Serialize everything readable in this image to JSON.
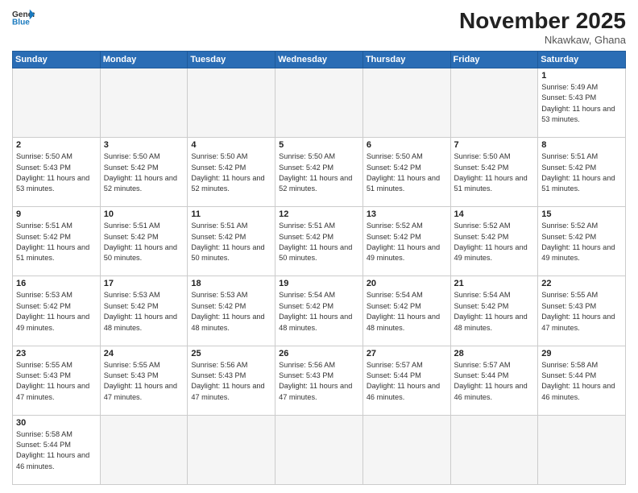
{
  "header": {
    "title": "November 2025",
    "location": "Nkawkaw, Ghana",
    "logo_general": "General",
    "logo_blue": "Blue"
  },
  "days_header": [
    "Sunday",
    "Monday",
    "Tuesday",
    "Wednesday",
    "Thursday",
    "Friday",
    "Saturday"
  ],
  "weeks": [
    {
      "cells": [
        {
          "day": "",
          "empty": true
        },
        {
          "day": "",
          "empty": true
        },
        {
          "day": "",
          "empty": true
        },
        {
          "day": "",
          "empty": true
        },
        {
          "day": "",
          "empty": true
        },
        {
          "day": "",
          "empty": true
        },
        {
          "day": "1",
          "empty": false,
          "sunrise": "Sunrise: 5:49 AM",
          "sunset": "Sunset: 5:43 PM",
          "daylight": "Daylight: 11 hours and 53 minutes."
        }
      ]
    },
    {
      "cells": [
        {
          "day": "2",
          "empty": false,
          "sunrise": "Sunrise: 5:50 AM",
          "sunset": "Sunset: 5:43 PM",
          "daylight": "Daylight: 11 hours and 53 minutes."
        },
        {
          "day": "3",
          "empty": false,
          "sunrise": "Sunrise: 5:50 AM",
          "sunset": "Sunset: 5:42 PM",
          "daylight": "Daylight: 11 hours and 52 minutes."
        },
        {
          "day": "4",
          "empty": false,
          "sunrise": "Sunrise: 5:50 AM",
          "sunset": "Sunset: 5:42 PM",
          "daylight": "Daylight: 11 hours and 52 minutes."
        },
        {
          "day": "5",
          "empty": false,
          "sunrise": "Sunrise: 5:50 AM",
          "sunset": "Sunset: 5:42 PM",
          "daylight": "Daylight: 11 hours and 52 minutes."
        },
        {
          "day": "6",
          "empty": false,
          "sunrise": "Sunrise: 5:50 AM",
          "sunset": "Sunset: 5:42 PM",
          "daylight": "Daylight: 11 hours and 51 minutes."
        },
        {
          "day": "7",
          "empty": false,
          "sunrise": "Sunrise: 5:50 AM",
          "sunset": "Sunset: 5:42 PM",
          "daylight": "Daylight: 11 hours and 51 minutes."
        },
        {
          "day": "8",
          "empty": false,
          "sunrise": "Sunrise: 5:51 AM",
          "sunset": "Sunset: 5:42 PM",
          "daylight": "Daylight: 11 hours and 51 minutes."
        }
      ]
    },
    {
      "cells": [
        {
          "day": "9",
          "empty": false,
          "sunrise": "Sunrise: 5:51 AM",
          "sunset": "Sunset: 5:42 PM",
          "daylight": "Daylight: 11 hours and 51 minutes."
        },
        {
          "day": "10",
          "empty": false,
          "sunrise": "Sunrise: 5:51 AM",
          "sunset": "Sunset: 5:42 PM",
          "daylight": "Daylight: 11 hours and 50 minutes."
        },
        {
          "day": "11",
          "empty": false,
          "sunrise": "Sunrise: 5:51 AM",
          "sunset": "Sunset: 5:42 PM",
          "daylight": "Daylight: 11 hours and 50 minutes."
        },
        {
          "day": "12",
          "empty": false,
          "sunrise": "Sunrise: 5:51 AM",
          "sunset": "Sunset: 5:42 PM",
          "daylight": "Daylight: 11 hours and 50 minutes."
        },
        {
          "day": "13",
          "empty": false,
          "sunrise": "Sunrise: 5:52 AM",
          "sunset": "Sunset: 5:42 PM",
          "daylight": "Daylight: 11 hours and 49 minutes."
        },
        {
          "day": "14",
          "empty": false,
          "sunrise": "Sunrise: 5:52 AM",
          "sunset": "Sunset: 5:42 PM",
          "daylight": "Daylight: 11 hours and 49 minutes."
        },
        {
          "day": "15",
          "empty": false,
          "sunrise": "Sunrise: 5:52 AM",
          "sunset": "Sunset: 5:42 PM",
          "daylight": "Daylight: 11 hours and 49 minutes."
        }
      ]
    },
    {
      "cells": [
        {
          "day": "16",
          "empty": false,
          "sunrise": "Sunrise: 5:53 AM",
          "sunset": "Sunset: 5:42 PM",
          "daylight": "Daylight: 11 hours and 49 minutes."
        },
        {
          "day": "17",
          "empty": false,
          "sunrise": "Sunrise: 5:53 AM",
          "sunset": "Sunset: 5:42 PM",
          "daylight": "Daylight: 11 hours and 48 minutes."
        },
        {
          "day": "18",
          "empty": false,
          "sunrise": "Sunrise: 5:53 AM",
          "sunset": "Sunset: 5:42 PM",
          "daylight": "Daylight: 11 hours and 48 minutes."
        },
        {
          "day": "19",
          "empty": false,
          "sunrise": "Sunrise: 5:54 AM",
          "sunset": "Sunset: 5:42 PM",
          "daylight": "Daylight: 11 hours and 48 minutes."
        },
        {
          "day": "20",
          "empty": false,
          "sunrise": "Sunrise: 5:54 AM",
          "sunset": "Sunset: 5:42 PM",
          "daylight": "Daylight: 11 hours and 48 minutes."
        },
        {
          "day": "21",
          "empty": false,
          "sunrise": "Sunrise: 5:54 AM",
          "sunset": "Sunset: 5:42 PM",
          "daylight": "Daylight: 11 hours and 48 minutes."
        },
        {
          "day": "22",
          "empty": false,
          "sunrise": "Sunrise: 5:55 AM",
          "sunset": "Sunset: 5:43 PM",
          "daylight": "Daylight: 11 hours and 47 minutes."
        }
      ]
    },
    {
      "cells": [
        {
          "day": "23",
          "empty": false,
          "sunrise": "Sunrise: 5:55 AM",
          "sunset": "Sunset: 5:43 PM",
          "daylight": "Daylight: 11 hours and 47 minutes."
        },
        {
          "day": "24",
          "empty": false,
          "sunrise": "Sunrise: 5:55 AM",
          "sunset": "Sunset: 5:43 PM",
          "daylight": "Daylight: 11 hours and 47 minutes."
        },
        {
          "day": "25",
          "empty": false,
          "sunrise": "Sunrise: 5:56 AM",
          "sunset": "Sunset: 5:43 PM",
          "daylight": "Daylight: 11 hours and 47 minutes."
        },
        {
          "day": "26",
          "empty": false,
          "sunrise": "Sunrise: 5:56 AM",
          "sunset": "Sunset: 5:43 PM",
          "daylight": "Daylight: 11 hours and 47 minutes."
        },
        {
          "day": "27",
          "empty": false,
          "sunrise": "Sunrise: 5:57 AM",
          "sunset": "Sunset: 5:44 PM",
          "daylight": "Daylight: 11 hours and 46 minutes."
        },
        {
          "day": "28",
          "empty": false,
          "sunrise": "Sunrise: 5:57 AM",
          "sunset": "Sunset: 5:44 PM",
          "daylight": "Daylight: 11 hours and 46 minutes."
        },
        {
          "day": "29",
          "empty": false,
          "sunrise": "Sunrise: 5:58 AM",
          "sunset": "Sunset: 5:44 PM",
          "daylight": "Daylight: 11 hours and 46 minutes."
        }
      ]
    },
    {
      "cells": [
        {
          "day": "30",
          "empty": false,
          "sunrise": "Sunrise: 5:58 AM",
          "sunset": "Sunset: 5:44 PM",
          "daylight": "Daylight: 11 hours and 46 minutes."
        },
        {
          "day": "",
          "empty": true
        },
        {
          "day": "",
          "empty": true
        },
        {
          "day": "",
          "empty": true
        },
        {
          "day": "",
          "empty": true
        },
        {
          "day": "",
          "empty": true
        },
        {
          "day": "",
          "empty": true
        }
      ]
    }
  ]
}
